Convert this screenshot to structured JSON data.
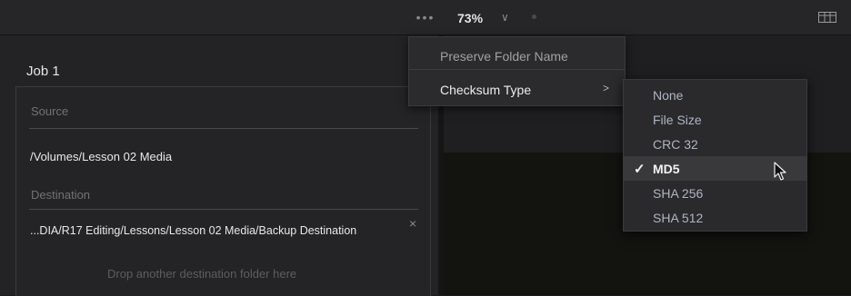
{
  "topbar": {
    "more_label": "•••",
    "zoom": "73%",
    "zoom_chevron": "∨"
  },
  "job": {
    "title": "Job 1",
    "source_label": "Source",
    "source_value": "/Volumes/Lesson 02 Media",
    "destination_label": "Destination",
    "destination_value": "...DIA/R17 Editing/Lessons/Lesson 02 Media/Backup Destination",
    "clear_icon": "×",
    "drop_hint": "Drop another destination folder here"
  },
  "menu": {
    "items": [
      {
        "label": "Preserve Folder Name"
      },
      {
        "label": "Checksum Type",
        "submenu_chevron": ">"
      }
    ]
  },
  "checksum_submenu": {
    "checkmark": "✓",
    "selected": "MD5",
    "options": [
      "None",
      "File Size",
      "CRC 32",
      "MD5",
      "SHA 256",
      "SHA 512"
    ]
  }
}
